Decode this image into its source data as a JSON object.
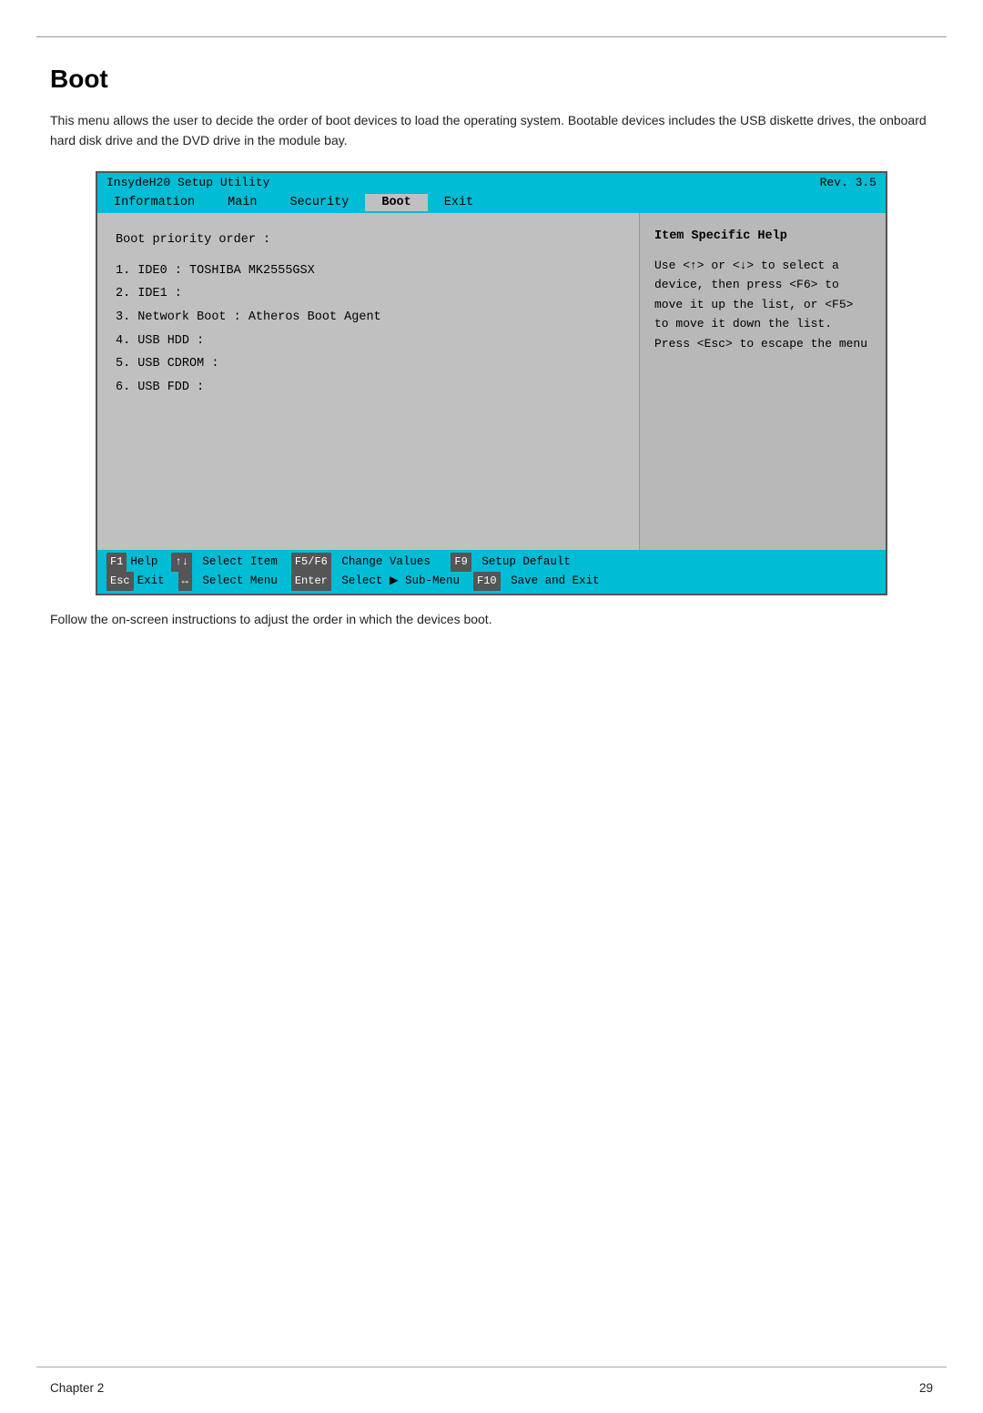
{
  "page": {
    "title": "Boot",
    "intro": "This menu allows the user to decide the order of boot devices to load the operating system. Bootable devices includes the USB diskette drives, the onboard hard disk drive and the DVD drive in the module bay.",
    "follow_text": "Follow the on-screen instructions to adjust the order in which the devices boot.",
    "footer": {
      "chapter": "Chapter 2",
      "page_number": "29"
    }
  },
  "bios": {
    "title": "InsydeH20 Setup Utility",
    "rev_label": "Rev.  3.5",
    "nav_items": [
      "Information",
      "Main",
      "Security",
      "Boot",
      "Exit"
    ],
    "active_nav": "Boot",
    "section_label": "Boot priority order :",
    "boot_list": [
      "1. IDE0 :  TOSHIBA MK2555GSX",
      "2. IDE1 :",
      "3. Network Boot :  Atheros Boot Agent",
      "4. USB HDD :",
      "5. USB CDROM :",
      "6. USB FDD :"
    ],
    "help_title": "Item Specific Help",
    "help_text": "Use <↑> or <↓> to select a device, then press <F6> to move it up the list, or <F5> to move it down the list. Press <Esc> to escape the menu",
    "footer_row1": {
      "f1_label": "F1",
      "f1_text": "Help",
      "arrow_updown": "↑↓",
      "select_item_label": "Select",
      "select_item_text": "Item",
      "f5f6_label": "F5/F6",
      "change_values_label": "Change Values",
      "f9_label": "F9",
      "setup_default_label": "Setup Default"
    },
    "footer_row2": {
      "esc_label": "Esc",
      "esc_text": "Exit",
      "arrow_lr": "↔",
      "select_menu_label": "Select",
      "select_menu_text": "Menu",
      "enter_label": "Enter",
      "select_sub_label": "Select ▶ Sub-Menu",
      "f10_label": "F10",
      "save_exit_label": "Save and Exit"
    }
  }
}
